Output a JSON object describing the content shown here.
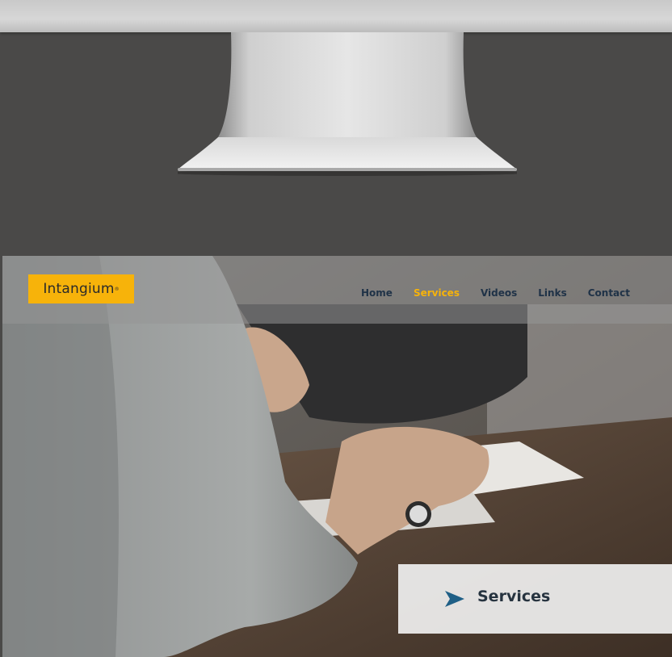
{
  "colors": {
    "accent": "#f7b30a",
    "nav_text": "#1f3247",
    "arrow": "#1f5f86"
  },
  "logo": {
    "text": "Intangium",
    "mark": "®"
  },
  "nav": {
    "items": [
      {
        "label": "Home",
        "active": false
      },
      {
        "label": "Services",
        "active": true
      },
      {
        "label": "Videos",
        "active": false
      },
      {
        "label": "Links",
        "active": false
      },
      {
        "label": "Contact",
        "active": false
      }
    ]
  },
  "banner": {
    "icon": "arrow-right-icon",
    "title": "Services"
  }
}
